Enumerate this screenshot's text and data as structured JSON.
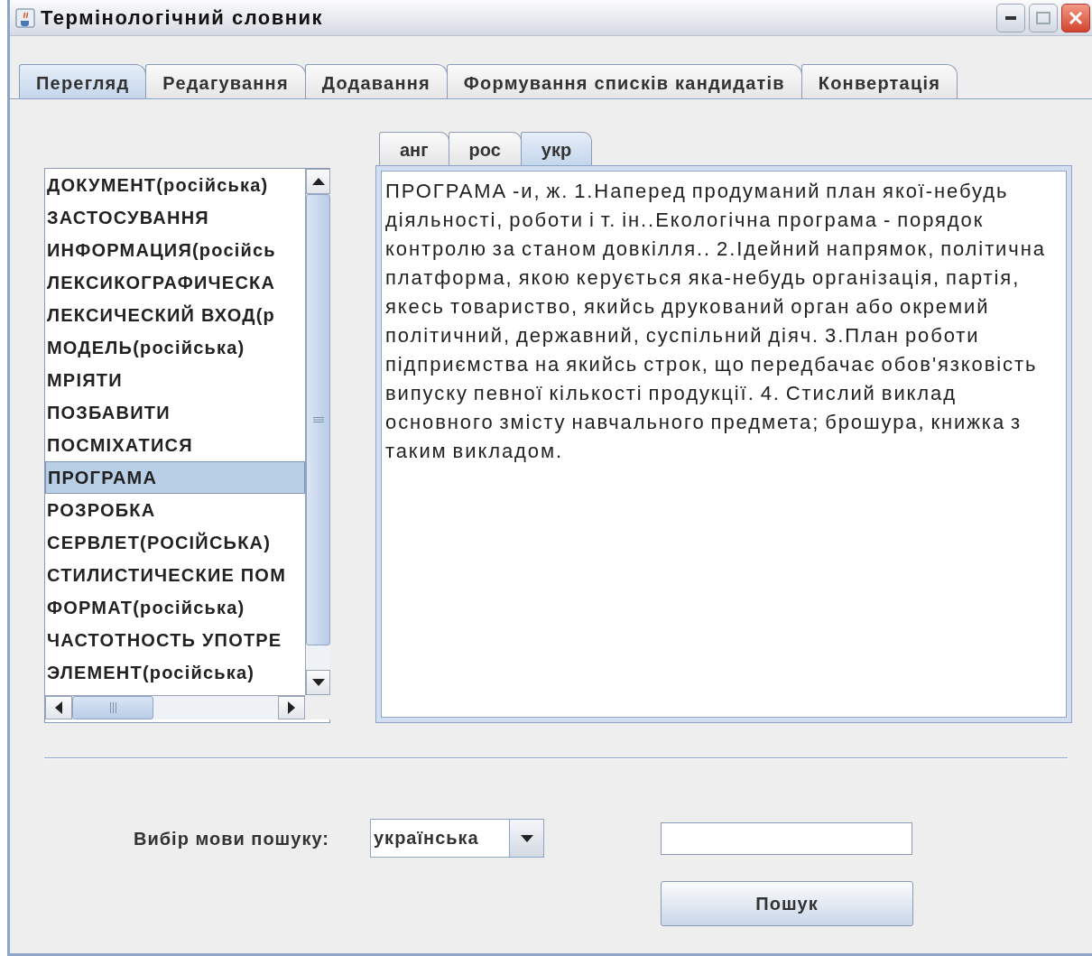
{
  "window": {
    "title": "Термінологічний словник"
  },
  "tabs": [
    {
      "label": "Перегляд",
      "selected": true
    },
    {
      "label": "Редагування",
      "selected": false
    },
    {
      "label": "Додавання",
      "selected": false
    },
    {
      "label": "Формування списків кандидатів",
      "selected": false
    },
    {
      "label": "Конвертація",
      "selected": false
    }
  ],
  "term_list": {
    "items": [
      {
        "label": "ДОКУМЕНТ(російська)",
        "selected": false
      },
      {
        "label": "ЗАСТОСУВАННЯ",
        "selected": false
      },
      {
        "label": "ИНФОРМАЦИЯ(російсь",
        "selected": false
      },
      {
        "label": "ЛЕКСИКОГРАФИЧЕСКА",
        "selected": false
      },
      {
        "label": "ЛЕКСИЧЕСКИЙ ВХОД(р",
        "selected": false
      },
      {
        "label": "МОДЕЛЬ(російська)",
        "selected": false
      },
      {
        "label": "МРІЯТИ",
        "selected": false
      },
      {
        "label": "ПОЗБАВИТИ",
        "selected": false
      },
      {
        "label": "ПОСМІХАТИСЯ",
        "selected": false
      },
      {
        "label": "ПРОГРАМА",
        "selected": true
      },
      {
        "label": "РОЗРОБКА",
        "selected": false
      },
      {
        "label": "СЕРВЛЕТ(РОСІЙСЬКА)",
        "selected": false
      },
      {
        "label": "СТИЛИСТИЧЕСКИЕ ПОМ",
        "selected": false
      },
      {
        "label": "ФОРМАТ(російська)",
        "selected": false
      },
      {
        "label": "ЧАСТОТНОСТЬ УПОТРЕ",
        "selected": false
      },
      {
        "label": "ЭЛЕМЕНТ(російська)",
        "selected": false
      }
    ]
  },
  "language_tabs": [
    {
      "label": "анг",
      "selected": false
    },
    {
      "label": "рос",
      "selected": false
    },
    {
      "label": "укр",
      "selected": true
    }
  ],
  "definition": "ПРОГРАМА -и, ж. 1.Наперед продуманий план якої-небудь діяльності, роботи і т. ін..Екологічна програма - порядок контролю за станом довкілля.. 2.Ідейний напрямок, політична платформа, якою керується яка-небудь організація, партія, якесь товариство, якийсь друкований орган або окремий політичний, державний, суспільний діяч. 3.План роботи підприємства на якийсь строк, що передбачає обов'язковість випуску певної кількості продукції. 4. Стислий виклад основного змісту навчального предмета; брошура, книжка з таким викладом.",
  "search": {
    "language_label": "Вибір мови пошуку:",
    "language": "українська",
    "button": "Пошук"
  }
}
